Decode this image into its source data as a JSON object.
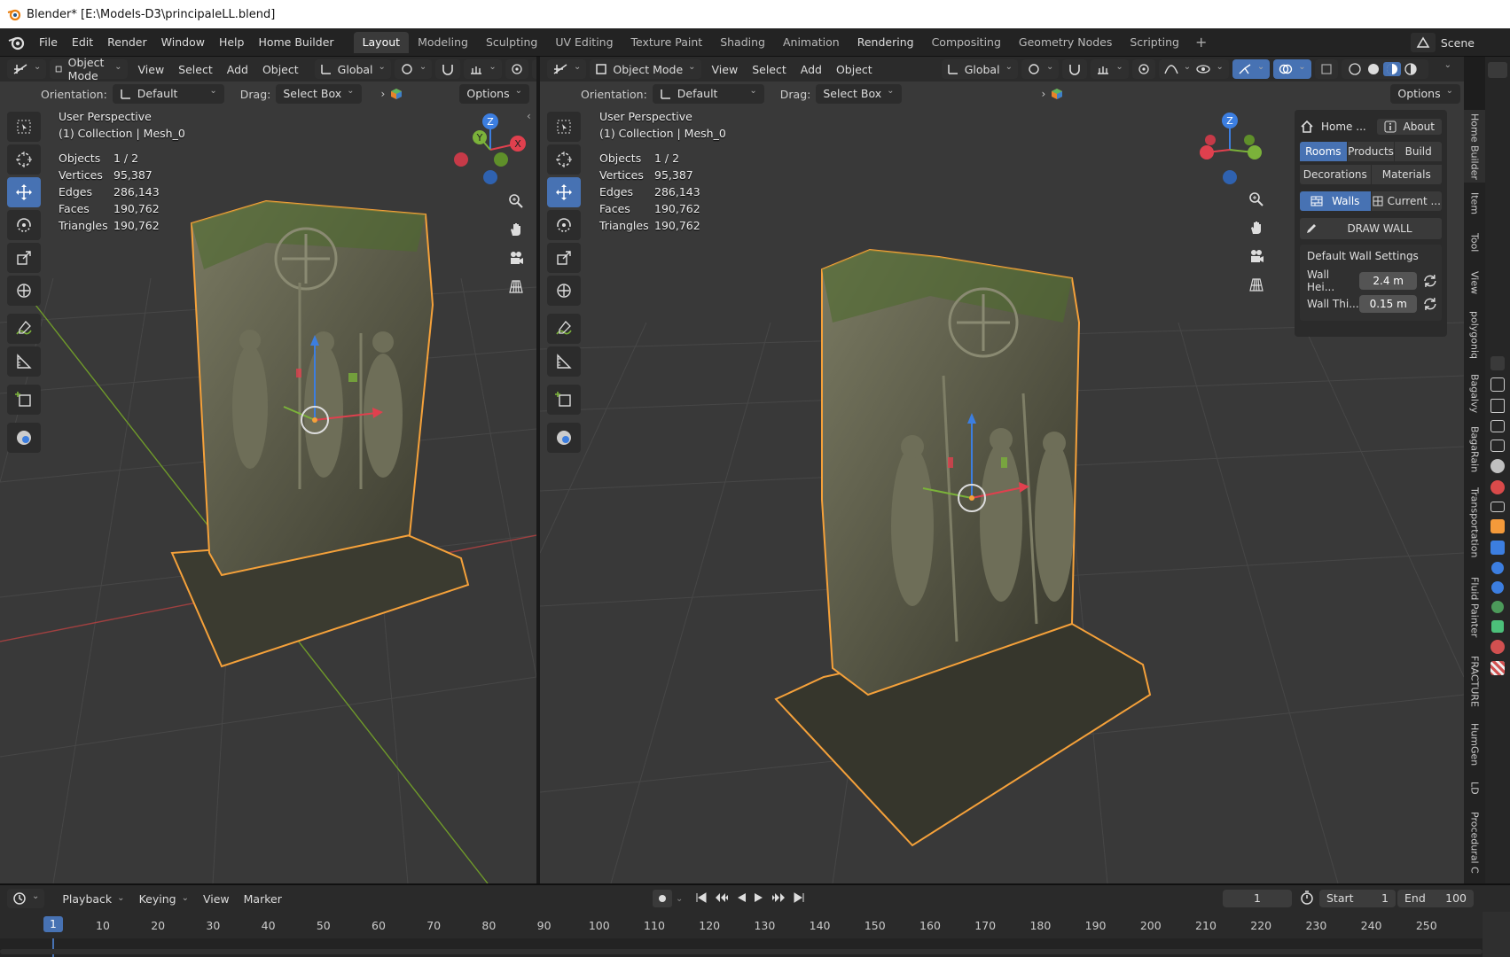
{
  "window": {
    "title": "Blender* [E:\\Models-D3\\principaleLL.blend]"
  },
  "menu": [
    "File",
    "Edit",
    "Render",
    "Window",
    "Help",
    "Home Builder"
  ],
  "workspaces": [
    "Layout",
    "Modeling",
    "Sculpting",
    "UV Editing",
    "Texture Paint",
    "Shading",
    "Animation",
    "Rendering",
    "Compositing",
    "Geometry Nodes",
    "Scripting"
  ],
  "active_workspace": "Layout",
  "scene": "Scene",
  "viewport_header": {
    "mode": "Object Mode",
    "menus": [
      "View",
      "Select",
      "Add",
      "Object"
    ],
    "transform": "Global",
    "orientation_label": "Orientation:",
    "orientation_value": "Default",
    "drag_label": "Drag:",
    "drag_value": "Select Box",
    "options": "Options"
  },
  "viewport_info": {
    "perspective": "User Perspective",
    "collection": "(1) Collection | Mesh_0",
    "stats": [
      {
        "k": "Objects",
        "v": "1 / 2"
      },
      {
        "k": "Vertices",
        "v": "95,387"
      },
      {
        "k": "Edges",
        "v": "286,143"
      },
      {
        "k": "Faces",
        "v": "190,762"
      },
      {
        "k": "Triangles",
        "v": "190,762"
      }
    ]
  },
  "gizmo": {
    "z": "Z",
    "y": "Y",
    "x": "X"
  },
  "npanel": {
    "home": "Home ...",
    "about": "About",
    "tabs_row1": [
      "Rooms",
      "Products",
      "Build"
    ],
    "tabs_row2": [
      "Decorations",
      "Materials"
    ],
    "walls": "Walls",
    "current": "Current ...",
    "draw_wall": "DRAW WALL",
    "section_title": "Default Wall Settings",
    "wall_height_label": "Wall Hei...",
    "wall_height_value": "2.4 m",
    "wall_thickness_label": "Wall Thi...",
    "wall_thickness_value": "0.15 m"
  },
  "side_tabs": [
    "Home Builder",
    "Item",
    "Tool",
    "View",
    "polygoniq",
    "Bagalvy",
    "BagaRain",
    "Transportation",
    "Fluid Painter",
    "FRACTURE",
    "HumGen",
    "LD",
    "Procedural C"
  ],
  "timeline": {
    "menus": [
      "Playback",
      "Keying",
      "View",
      "Marker"
    ],
    "current_frame": "1",
    "start_label": "Start",
    "start_value": "1",
    "end_label": "End",
    "end_value": "100",
    "playhead": "1",
    "ticks": [
      "10",
      "20",
      "30",
      "40",
      "50",
      "60",
      "70",
      "80",
      "90",
      "100",
      "110",
      "120",
      "130",
      "140",
      "150",
      "160",
      "170",
      "180",
      "190",
      "200",
      "210",
      "220",
      "230",
      "240",
      "250"
    ]
  },
  "colors": {
    "accent": "#4772b3",
    "selection": "#f5a13a",
    "x_axis": "#e0404e",
    "y_axis": "#7bb23a",
    "z_axis": "#3c7ee0"
  }
}
